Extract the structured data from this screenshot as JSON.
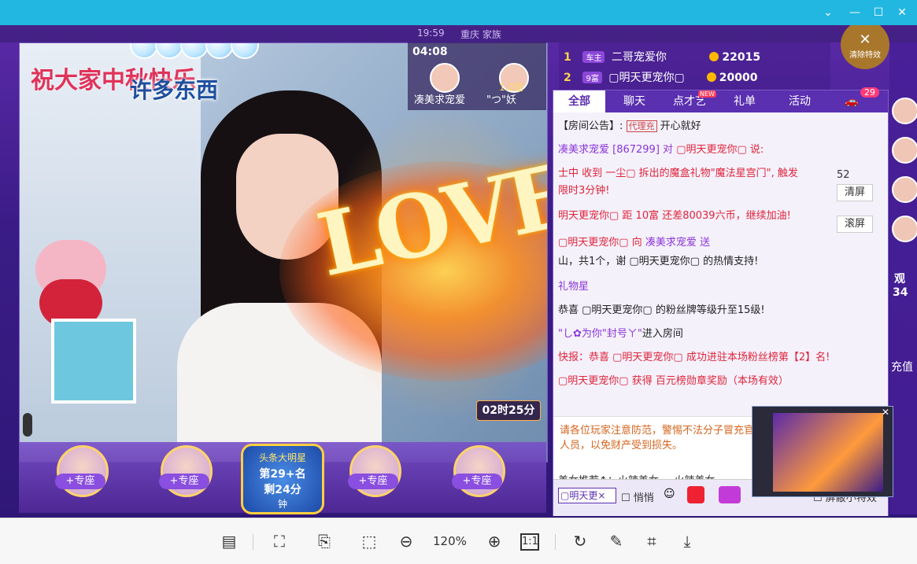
{
  "window": {
    "minimize_glyph": "—",
    "maximize_glyph": "☐",
    "close_glyph": "✕",
    "collapse_glyph": "⌄"
  },
  "top_strip": {
    "time": "19:59",
    "room_meta": "重庆  家族"
  },
  "video": {
    "greeting_line1": "祝大家中秋快乐",
    "greeting_line2": "许多东西",
    "effect_word": "LOVE",
    "timer": "02时25分",
    "host_card": {
      "clock": "04:08",
      "left_name": "凑美求宠爱",
      "right_label": "1.2倍",
      "right_name": "\"つ\"妖"
    }
  },
  "gift_row": [
    {
      "label": "+专座"
    },
    {
      "label": "+专座"
    },
    {
      "label": "+专座"
    },
    {
      "label": "+专座"
    }
  ],
  "headline_badge": {
    "title": "头条大明星",
    "rank": "第29+名",
    "remaining": "剩24分",
    "unit": "钟"
  },
  "ranking": {
    "rows": [
      {
        "no": "1",
        "badge": "车主",
        "name": "二哥宠爱你",
        "score": "22015"
      },
      {
        "no": "2",
        "badge": "9富",
        "name": "▢明天更宠你▢",
        "score": "20000"
      }
    ],
    "clear_effects": "清除特效"
  },
  "chat": {
    "tabs": [
      "全部",
      "聊天",
      "点才艺",
      "礼单",
      "活动"
    ],
    "tab_new_badge": "NEW",
    "tab_count": "29",
    "messages": [
      {
        "prefix": "【房间公告】:",
        "text": "开心就好",
        "tag": "代理充"
      },
      {
        "prefix": "凑美求宠爱 [867299] 对",
        "text": "▢明天更宠你▢ 说:",
        "tag": ""
      },
      {
        "prefix": "士中 收到 一尘▢ 拆出的魔盒礼物",
        "text": "\"魔法星宫门\", 触发",
        "tag": ""
      },
      {
        "prefix": "",
        "text": "限时3分钟!",
        "tag": ""
      },
      {
        "prefix": "",
        "text": "明天更宠你▢ 距 10富 还差80039六币，继续加油!",
        "tag": ""
      },
      {
        "prefix": "▢明天更宠你▢ 向",
        "text": "凑美求宠爱 送",
        "tag": ""
      },
      {
        "prefix": "",
        "text": "山，共1个，谢 ▢明天更宠你▢ 的热情支持!",
        "tag": ""
      },
      {
        "prefix": "",
        "text": "礼物星",
        "tag": ""
      },
      {
        "prefix": "",
        "text": "恭喜 ▢明天更宠你▢ 的粉丝牌等级升至15级!",
        "tag": ""
      },
      {
        "prefix": "\"し✿为你\"封号ㄚ\"",
        "text": "进入房间",
        "tag": ""
      },
      {
        "prefix": "快报：恭喜 ▢明天更宠你▢",
        "text": "成功进驻本场粉丝榜第【2】名!",
        "tag": ""
      },
      {
        "prefix": "",
        "text": "▢明天更宠你▢ 获得 百元榜勋章奖励（本场有效）",
        "tag": ""
      }
    ],
    "side_count": "52",
    "side_clear": "清屏",
    "side_scroll": "滚屏",
    "notice": "请各位玩家注意防范，警惕不法分子冒充官方人员，以免财产受到损失。",
    "recommend": "美女推荐↑：火辣美女，，火辣美女",
    "input_name": "▢明天更×",
    "whisper": "悄悄",
    "hide_effects": "屏蔽小特效"
  },
  "right_strip": {
    "label1": "观",
    "label2": "34",
    "label3": "充值"
  },
  "toolbar": {
    "zoom": "120%",
    "fit_label": "1:1"
  }
}
